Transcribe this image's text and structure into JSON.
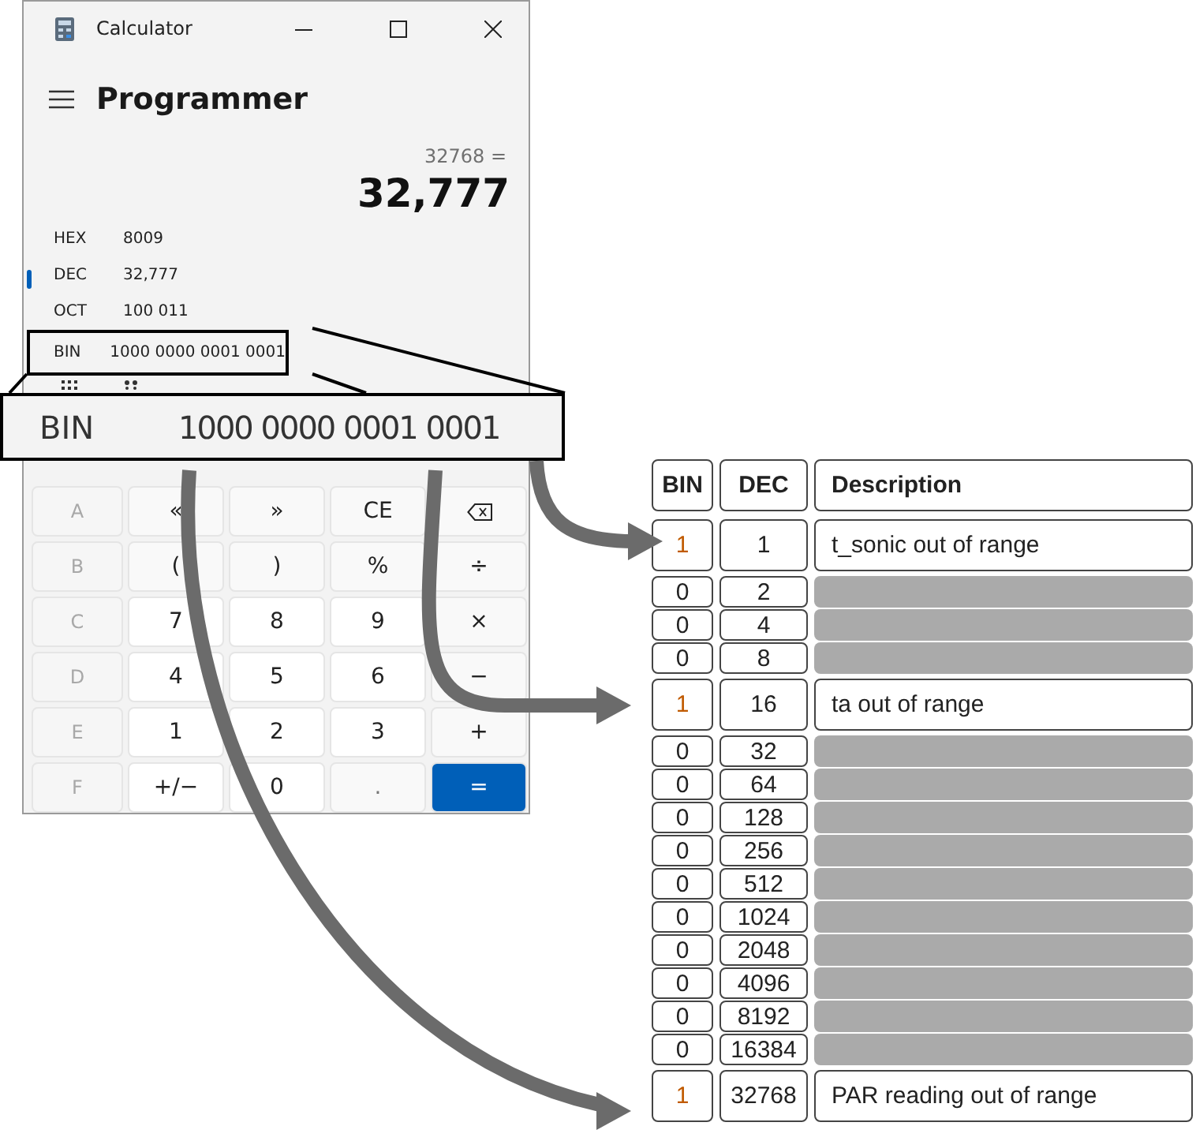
{
  "calculator": {
    "title": "Calculator",
    "mode": "Programmer",
    "expression": "32768 =",
    "result": "32,777",
    "radixes": [
      {
        "label": "HEX",
        "value": "8009",
        "selected": false,
        "framed": false
      },
      {
        "label": "DEC",
        "value": "32,777",
        "selected": true,
        "framed": false
      },
      {
        "label": "OCT",
        "value": "100 011",
        "selected": false,
        "framed": false
      },
      {
        "label": "BIN",
        "value": "1000 0000 0001 0001",
        "selected": false,
        "framed": true
      }
    ],
    "keys": [
      [
        {
          "kind": "letter",
          "label": "A"
        },
        {
          "kind": "op",
          "label": "«"
        },
        {
          "kind": "op",
          "label": "»"
        },
        {
          "kind": "op",
          "label": "CE"
        },
        {
          "kind": "backspace"
        }
      ],
      [
        {
          "kind": "letter",
          "label": "B"
        },
        {
          "kind": "op",
          "label": "("
        },
        {
          "kind": "op",
          "label": ")"
        },
        {
          "kind": "op",
          "label": "%"
        },
        {
          "kind": "op",
          "label": "÷"
        }
      ],
      [
        {
          "kind": "letter",
          "label": "C"
        },
        {
          "kind": "digit",
          "label": "7"
        },
        {
          "kind": "digit",
          "label": "8"
        },
        {
          "kind": "digit",
          "label": "9"
        },
        {
          "kind": "op",
          "label": "×"
        }
      ],
      [
        {
          "kind": "letter",
          "label": "D"
        },
        {
          "kind": "digit",
          "label": "4"
        },
        {
          "kind": "digit",
          "label": "5"
        },
        {
          "kind": "digit",
          "label": "6"
        },
        {
          "kind": "op",
          "label": "−"
        }
      ],
      [
        {
          "kind": "letter",
          "label": "E"
        },
        {
          "kind": "digit",
          "label": "1"
        },
        {
          "kind": "digit",
          "label": "2"
        },
        {
          "kind": "digit",
          "label": "3"
        },
        {
          "kind": "op",
          "label": "+"
        }
      ],
      [
        {
          "kind": "letter",
          "label": "F"
        },
        {
          "kind": "digit",
          "label": "+/−"
        },
        {
          "kind": "digit",
          "label": "0"
        },
        {
          "kind": "dot",
          "label": "."
        },
        {
          "kind": "equals",
          "label": "="
        }
      ]
    ]
  },
  "magnifier": {
    "label": "BIN",
    "value": "1000 0000 0001 0001"
  },
  "table": {
    "columns": [
      "BIN",
      "DEC",
      "Description"
    ],
    "rows": [
      {
        "kind": "described",
        "bin": "1",
        "dec": "1",
        "description": "t_sonic out of range"
      },
      {
        "kind": "blank",
        "bin": "0",
        "dec": "2"
      },
      {
        "kind": "blank",
        "bin": "0",
        "dec": "4"
      },
      {
        "kind": "blank",
        "bin": "0",
        "dec": "8"
      },
      {
        "kind": "described",
        "bin": "1",
        "dec": "16",
        "description": "ta out of range"
      },
      {
        "kind": "blank",
        "bin": "0",
        "dec": "32"
      },
      {
        "kind": "blank",
        "bin": "0",
        "dec": "64"
      },
      {
        "kind": "blank",
        "bin": "0",
        "dec": "128"
      },
      {
        "kind": "blank",
        "bin": "0",
        "dec": "256"
      },
      {
        "kind": "blank",
        "bin": "0",
        "dec": "512"
      },
      {
        "kind": "blank",
        "bin": "0",
        "dec": "1024"
      },
      {
        "kind": "blank",
        "bin": "0",
        "dec": "2048"
      },
      {
        "kind": "blank",
        "bin": "0",
        "dec": "4096"
      },
      {
        "kind": "blank",
        "bin": "0",
        "dec": "8192"
      },
      {
        "kind": "blank",
        "bin": "0",
        "dec": "16384"
      },
      {
        "kind": "described",
        "bin": "1",
        "dec": "32768",
        "description": "PAR reading out of range"
      }
    ]
  }
}
